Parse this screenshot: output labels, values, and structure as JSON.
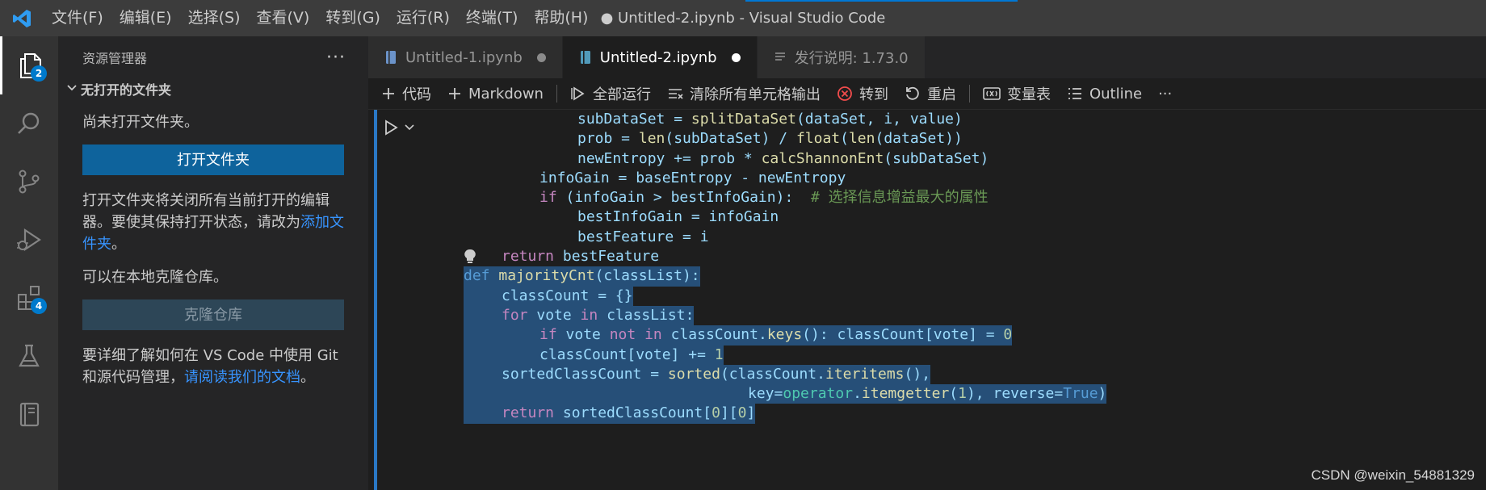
{
  "titlebar": {
    "menu": [
      "文件(F)",
      "编辑(E)",
      "选择(S)",
      "查看(V)",
      "转到(G)",
      "运行(R)",
      "终端(T)",
      "帮助(H)"
    ],
    "window_title": "● Untitled-2.ipynb - Visual Studio Code"
  },
  "activitybar": {
    "explorer_badge": "2",
    "extensions_badge": "4"
  },
  "sidebar": {
    "title": "资源管理器",
    "more": "···",
    "section_title": "无打开的文件夹",
    "no_folder_text": "尚未打开文件夹。",
    "open_folder_button": "打开文件夹",
    "open_folder_note": "打开文件夹将关闭所有当前打开的编辑器。要使其保持打开状态，请改为",
    "add_folder_link": "添加文件夹",
    "add_folder_suffix": "。",
    "clone_text": "可以在本地克隆仓库。",
    "clone_button": "克隆仓库",
    "git_text": "要详细了解如何在 VS Code 中使用 Git 和源代码管理，",
    "git_link": "请阅读我们的文档",
    "git_suffix": "。"
  },
  "tabs": [
    {
      "label": "Untitled-1.ipynb"
    },
    {
      "label": "Untitled-2.ipynb"
    },
    {
      "label": "发行说明: 1.73.0"
    }
  ],
  "toolbar": {
    "code": "代码",
    "markdown": "Markdown",
    "run_all": "全部运行",
    "clear_outputs": "清除所有单元格输出",
    "goto": "转到",
    "restart": "重启",
    "variables": "变量表",
    "outline": "Outline",
    "more": "···"
  },
  "code": {
    "l1": "subDataSet = splitDataSet(dataSet, i, value)",
    "l2": "prob = len(subDataSet) / float(len(dataSet))",
    "l3": "newEntropy += prob * calcShannonEnt(subDataSet)",
    "l4": "infoGain = baseEntropy - newEntropy",
    "l5": "if (infoGain > bestInfoGain):  # 选择信息增益最大的属性",
    "l6": "bestInfoGain = infoGain",
    "l7": "bestFeature = i",
    "l8": "return bestFeature",
    "l9": "def majorityCnt(classList):",
    "l10": "classCount = {}",
    "l11": "for vote in classList:",
    "l12": "if vote not in classCount.keys(): classCount[vote] = 0",
    "l13": "classCount[vote] += 1",
    "l14": "sortedClassCount = sorted(classCount.iteritems(),",
    "l15": "key=operator.itemgetter(1), reverse=True)",
    "l16": "return sortedClassCount[0][0]"
  },
  "watermark": "CSDN @weixin_54881329"
}
